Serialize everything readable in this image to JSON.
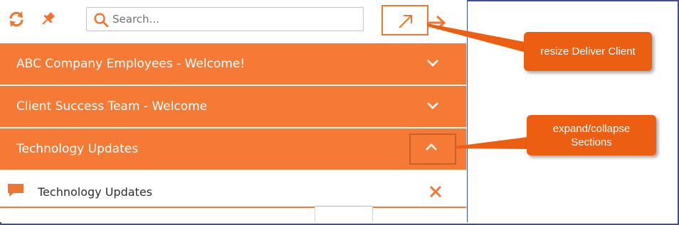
{
  "toolbar": {
    "refresh_icon": "refresh-icon",
    "pin_icon": "pin-icon",
    "search": {
      "placeholder": "Search...",
      "value": ""
    },
    "resize_icon": "diagonal-arrow-icon",
    "collapse_icon": "arrow-right-icon"
  },
  "sections": [
    {
      "label": "ABC Company Employees - Welcome!",
      "state": "collapsed"
    },
    {
      "label": "Client Success Team - Welcome",
      "state": "collapsed"
    },
    {
      "label": "Technology Updates",
      "state": "expanded"
    }
  ],
  "items": [
    {
      "label": "Technology Updates",
      "icon": "chat-bubble-icon",
      "action_icon": "close-icon"
    }
  ],
  "callouts": {
    "resize": "resize Deliver Client",
    "expand": "expand/collapse\nSections"
  },
  "colors": {
    "accent": "#f47a36",
    "callout": "#ec5e12",
    "border": "#3b4f9e"
  }
}
